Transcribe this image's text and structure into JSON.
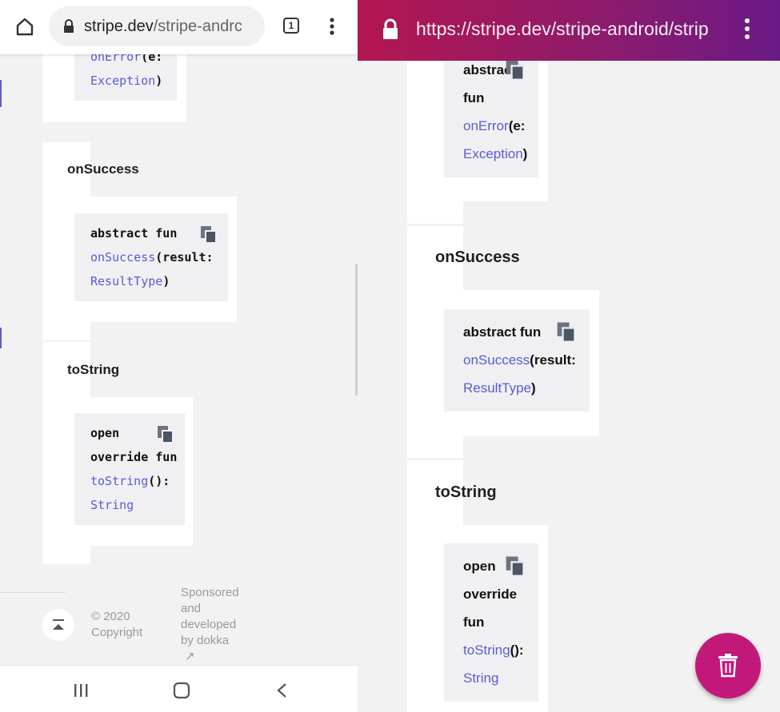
{
  "left": {
    "address_bar": {
      "url_host": "stripe.dev",
      "url_path": "/stripe-andrc",
      "tab_count": "1"
    },
    "top_code": {
      "fn": "onError",
      "param": "(e:",
      "type": "Exception",
      "close": ")"
    },
    "on_success": {
      "heading": "onSuccess",
      "line1": "abstract fun",
      "fn": "onSuccess",
      "param": "(result:",
      "type": "ResultType",
      "close": ")"
    },
    "to_string": {
      "heading": "toString",
      "line1": "open",
      "line2": "override fun",
      "fn": "toString",
      "suffix": "():",
      "type": "String"
    },
    "footer": {
      "copyright_year": "© 2020",
      "copyright_label": "Copyright",
      "sponsored": [
        "Sponsored",
        "and",
        "developed",
        "by dokka"
      ],
      "arrow": "↗"
    }
  },
  "right": {
    "address_bar": {
      "url": "https://stripe.dev/stripe-android/strip"
    },
    "top_code": {
      "line1": "abstrac",
      "line2": "fun",
      "fn": "onError",
      "param": "(e:",
      "type": "Exception",
      "close": ")"
    },
    "on_success": {
      "heading": "onSuccess",
      "line1": "abstract fun",
      "fn": "onSuccess",
      "param": "(result:",
      "type": "ResultType",
      "close": ")"
    },
    "to_string": {
      "heading": "toString",
      "line1": "open",
      "line2": "override",
      "line3": "fun",
      "fn": "toString",
      "suffix": "():",
      "type": "String"
    }
  },
  "colors": {
    "link": "#5b5bd6",
    "header_gradient_start": "#b3164f",
    "header_gradient_end": "#6a1a86",
    "fab": "#c2187a"
  },
  "icons": [
    "home-icon",
    "lock-icon",
    "tab-switcher-icon",
    "more-vert-icon",
    "copy-icon",
    "scroll-top-icon",
    "recent-apps-icon",
    "home-nav-icon",
    "back-nav-icon",
    "trash-icon"
  ]
}
